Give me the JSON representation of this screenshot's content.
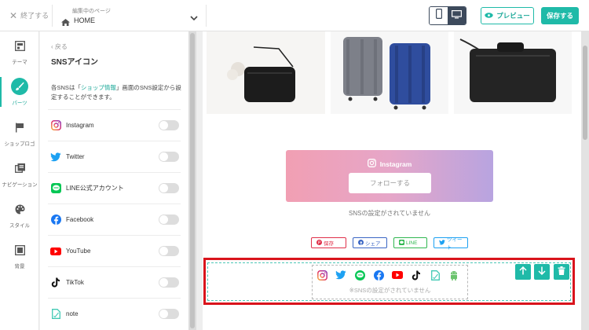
{
  "header": {
    "exit_label": "終了する",
    "page_select_caption": "編集中のページ",
    "page_select_value": "HOME",
    "preview_label": "プレビュー",
    "save_label": "保存する"
  },
  "rail": {
    "items": [
      {
        "label": "テーマ",
        "icon": "layout-icon"
      },
      {
        "label": "パーツ",
        "icon": "brush-icon"
      },
      {
        "label": "ショップロゴ",
        "icon": "flag-icon"
      },
      {
        "label": "ナビゲーション",
        "icon": "navigation-icon"
      },
      {
        "label": "スタイル",
        "icon": "palette-icon"
      },
      {
        "label": "背景",
        "icon": "background-icon"
      }
    ],
    "active": "パーツ"
  },
  "panel": {
    "back_label": "戻る",
    "title": "SNSアイコン",
    "desc_prefix": "各SNSは「",
    "desc_link": "ショップ情報",
    "desc_suffix": "」画面のSNS設定から設定することができます。",
    "sns": [
      {
        "name": "Instagram",
        "enabled": false
      },
      {
        "name": "Twitter",
        "enabled": false
      },
      {
        "name": "LINE公式アカウント",
        "enabled": false
      },
      {
        "name": "Facebook",
        "enabled": false
      },
      {
        "name": "YouTube",
        "enabled": false
      },
      {
        "name": "TikTok",
        "enabled": false
      },
      {
        "name": "note",
        "enabled": false
      }
    ]
  },
  "canvas": {
    "instagram_title": "Instagram",
    "follow_label": "フォローする",
    "instagram_note": "SNSの設定がされていません",
    "share_buttons": {
      "pinterest": "保存",
      "facebook": "シェア",
      "line": "LINE",
      "twitter": "ツイート"
    },
    "sns_block_note": "※SNSの設定がされていません"
  },
  "colors": {
    "accent": "#1fbaa8",
    "highlight": "#d9141c",
    "device_active": "#3d4a5c"
  }
}
